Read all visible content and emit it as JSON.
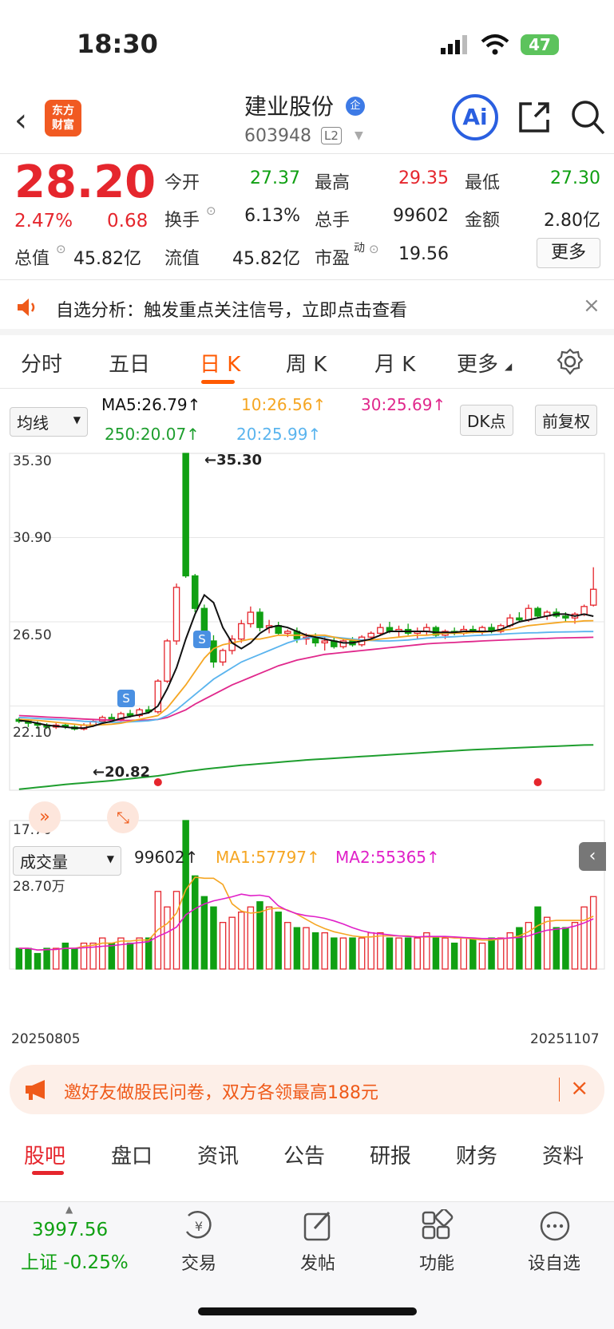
{
  "status": {
    "time": "18:30",
    "battery": "47"
  },
  "header": {
    "logo_line1": "东方",
    "logo_line2": "财富",
    "name": "建业股份",
    "name_badge": "企",
    "code": "603948",
    "level": "L2",
    "ai_label": "Ai"
  },
  "quote": {
    "price": "28.20",
    "change_pct": "2.47%",
    "change": "0.68",
    "open_label": "今开",
    "open": "27.37",
    "high_label": "最高",
    "high": "29.35",
    "low_label": "最低",
    "low": "27.30",
    "turnover_label": "换手",
    "turnover": "6.13%",
    "volume_label": "总手",
    "volume": "99602",
    "amount_label": "金额",
    "amount": "2.80亿",
    "mktcap_label": "总值",
    "mktcap": "45.82亿",
    "float_label": "流值",
    "float": "45.82亿",
    "pe_label": "市盈",
    "pe_sup": "动",
    "pe": "19.56",
    "more_button": "更多"
  },
  "notice": {
    "text": "自选分析：触发重点关注信号，立即点击查看"
  },
  "tabs": [
    "分时",
    "五日",
    "日 K",
    "周 K",
    "月 K",
    "更多"
  ],
  "ma_row": {
    "select": "均线",
    "ma5": "MA5:26.79↑",
    "ma10": "10:26.56↑",
    "ma30": "30:25.69↑",
    "ma250": "250:20.07↑",
    "ma20": "20:25.99↑",
    "dk_button": "DK点",
    "fq_button": "前复权"
  },
  "kchart": {
    "y_labels": [
      "35.30",
      "30.90",
      "26.50",
      "22.10",
      "17.70"
    ],
    "high_marker": "←35.30",
    "low_marker": "←20.82",
    "signal_label": "S"
  },
  "volume": {
    "select": "成交量",
    "value": "99602↑",
    "ma1": "MA1:57797↑",
    "ma2": "MA2:55365↑",
    "top_label": "28.70万",
    "start_date": "20250805",
    "end_date": "20251107"
  },
  "colors": {
    "up": "#e5262d",
    "down": "#10a013",
    "ma5": "#111111",
    "ma10": "#f5a623",
    "ma20": "#5ab4ee",
    "ma30": "#e0288c",
    "ma250": "#1e9e2e",
    "accent": "#ff5a00"
  },
  "chart_data": {
    "type": "candlestick",
    "x_start": "20250805",
    "x_end": "20251107",
    "ylim": [
      17.7,
      35.3
    ],
    "candles": [
      [
        21.4,
        21.5,
        21.2,
        21.3
      ],
      [
        21.3,
        21.4,
        21.0,
        21.2
      ],
      [
        21.2,
        21.3,
        20.9,
        21.1
      ],
      [
        21.1,
        21.2,
        20.9,
        21.0
      ],
      [
        21.0,
        21.2,
        20.9,
        21.1
      ],
      [
        21.1,
        21.2,
        20.9,
        21.0
      ],
      [
        21.0,
        21.1,
        20.82,
        20.9
      ],
      [
        20.9,
        21.2,
        20.82,
        21.1
      ],
      [
        21.1,
        21.4,
        21.0,
        21.3
      ],
      [
        21.3,
        21.6,
        21.2,
        21.5
      ],
      [
        21.5,
        21.7,
        21.3,
        21.4
      ],
      [
        21.4,
        21.8,
        21.3,
        21.7
      ],
      [
        21.7,
        21.9,
        21.5,
        21.6
      ],
      [
        21.6,
        22.0,
        21.5,
        21.9
      ],
      [
        21.9,
        22.1,
        21.7,
        21.8
      ],
      [
        21.8,
        23.5,
        21.7,
        23.4
      ],
      [
        23.4,
        25.6,
        23.3,
        25.5
      ],
      [
        25.5,
        28.5,
        25.3,
        28.3
      ],
      [
        35.3,
        35.3,
        28.8,
        28.9
      ],
      [
        28.9,
        29.0,
        27.0,
        27.2
      ],
      [
        27.2,
        27.4,
        25.3,
        25.5
      ],
      [
        25.5,
        25.8,
        24.1,
        24.4
      ],
      [
        24.4,
        25.1,
        24.2,
        25.0
      ],
      [
        25.0,
        25.8,
        24.8,
        25.6
      ],
      [
        25.6,
        26.6,
        25.4,
        26.4
      ],
      [
        26.4,
        27.3,
        26.2,
        27.0
      ],
      [
        27.0,
        27.2,
        26.0,
        26.2
      ],
      [
        26.2,
        26.6,
        25.9,
        26.3
      ],
      [
        26.3,
        26.5,
        25.8,
        25.9
      ],
      [
        25.9,
        26.1,
        25.7,
        26.0
      ],
      [
        26.0,
        26.2,
        25.4,
        25.6
      ],
      [
        25.6,
        25.9,
        25.3,
        25.7
      ],
      [
        25.7,
        25.9,
        25.2,
        25.4
      ],
      [
        25.4,
        25.7,
        25.0,
        25.5
      ],
      [
        25.5,
        25.7,
        25.1,
        25.2
      ],
      [
        25.2,
        25.6,
        25.1,
        25.5
      ],
      [
        25.5,
        25.7,
        25.2,
        25.3
      ],
      [
        25.3,
        25.8,
        25.2,
        25.7
      ],
      [
        25.7,
        26.0,
        25.5,
        25.9
      ],
      [
        25.9,
        26.4,
        25.8,
        26.2
      ],
      [
        26.2,
        26.5,
        25.9,
        26.0
      ],
      [
        26.0,
        26.3,
        25.7,
        26.1
      ],
      [
        26.1,
        26.4,
        25.8,
        25.9
      ],
      [
        25.9,
        26.2,
        25.6,
        26.0
      ],
      [
        26.0,
        26.4,
        25.8,
        26.2
      ],
      [
        26.2,
        26.3,
        25.7,
        25.8
      ],
      [
        25.8,
        26.1,
        25.6,
        26.0
      ],
      [
        26.0,
        26.2,
        25.8,
        25.9
      ],
      [
        25.9,
        26.3,
        25.8,
        26.1
      ],
      [
        26.1,
        26.3,
        25.9,
        26.0
      ],
      [
        26.0,
        26.3,
        25.8,
        26.2
      ],
      [
        26.2,
        26.4,
        25.9,
        26.0
      ],
      [
        26.0,
        26.4,
        25.9,
        26.3
      ],
      [
        26.3,
        26.9,
        26.2,
        26.7
      ],
      [
        26.7,
        27.0,
        26.5,
        26.6
      ],
      [
        26.6,
        27.4,
        26.5,
        27.2
      ],
      [
        27.2,
        27.3,
        26.7,
        26.8
      ],
      [
        26.8,
        27.1,
        26.6,
        27.0
      ],
      [
        27.0,
        27.2,
        26.7,
        26.8
      ],
      [
        26.8,
        27.0,
        26.5,
        26.7
      ],
      [
        26.7,
        27.0,
        26.4,
        26.9
      ],
      [
        26.9,
        27.4,
        26.8,
        27.3
      ],
      [
        27.37,
        29.35,
        27.3,
        28.2
      ]
    ],
    "volumes": [
      4,
      4,
      3,
      4,
      4,
      5,
      4,
      5,
      5,
      6,
      5,
      6,
      5,
      6,
      6,
      15,
      12,
      15,
      28.7,
      18,
      14,
      12,
      9,
      10,
      11,
      12,
      13,
      12,
      11,
      9,
      8,
      8,
      7,
      7,
      6,
      6,
      6,
      6,
      7,
      7,
      6,
      6,
      6,
      6,
      7,
      6,
      6,
      5,
      6,
      6,
      5,
      6,
      6,
      7,
      8,
      9,
      12,
      10,
      8,
      8,
      9,
      12,
      14
    ],
    "ma5": [
      21.35,
      21.3,
      21.2,
      21.1,
      21.05,
      21.0,
      20.95,
      20.95,
      21.05,
      21.2,
      21.3,
      21.45,
      21.55,
      21.65,
      21.75,
      22.1,
      23.0,
      24.1,
      25.6,
      26.9,
      27.9,
      27.5,
      26.2,
      25.4,
      25.1,
      25.4,
      25.9,
      26.2,
      26.3,
      26.2,
      26.0,
      25.8,
      25.7,
      25.6,
      25.5,
      25.4,
      25.4,
      25.5,
      25.6,
      25.8,
      26.0,
      26.0,
      26.0,
      26.0,
      26.0,
      25.95,
      25.95,
      25.95,
      26.0,
      26.0,
      26.0,
      26.0,
      26.1,
      26.3,
      26.5,
      26.6,
      26.7,
      26.8,
      26.9,
      26.9,
      26.8,
      26.9,
      26.79
    ],
    "ma10": [
      21.4,
      21.38,
      21.35,
      21.3,
      21.25,
      21.2,
      21.15,
      21.1,
      21.1,
      21.12,
      21.15,
      21.2,
      21.3,
      21.4,
      21.5,
      21.6,
      22.0,
      22.6,
      23.2,
      23.9,
      24.6,
      25.1,
      25.3,
      25.4,
      25.5,
      25.6,
      25.6,
      25.7,
      25.8,
      25.8,
      25.8,
      25.8,
      25.8,
      25.8,
      25.7,
      25.6,
      25.55,
      25.5,
      25.55,
      25.6,
      25.65,
      25.7,
      25.75,
      25.8,
      25.8,
      25.85,
      25.9,
      25.9,
      25.9,
      25.95,
      25.95,
      26.0,
      26.05,
      26.1,
      26.2,
      26.3,
      26.35,
      26.4,
      26.45,
      26.5,
      26.5,
      26.55,
      26.56
    ],
    "ma20": [
      21.5,
      21.48,
      21.45,
      21.42,
      21.4,
      21.38,
      21.35,
      21.3,
      21.28,
      21.25,
      21.25,
      21.25,
      21.27,
      21.3,
      21.33,
      21.4,
      21.6,
      21.9,
      22.3,
      22.7,
      23.1,
      23.5,
      23.8,
      24.1,
      24.4,
      24.6,
      24.8,
      25.0,
      25.2,
      25.4,
      25.55,
      25.65,
      25.7,
      25.72,
      25.7,
      25.65,
      25.6,
      25.55,
      25.52,
      25.5,
      25.5,
      25.52,
      25.55,
      25.6,
      25.65,
      25.68,
      25.7,
      25.72,
      25.75,
      25.78,
      25.8,
      25.82,
      25.85,
      25.88,
      25.9,
      25.92,
      25.93,
      25.95,
      25.96,
      25.97,
      25.98,
      25.99,
      25.99
    ],
    "ma30": [
      21.6,
      21.58,
      21.55,
      21.52,
      21.5,
      21.48,
      21.45,
      21.42,
      21.4,
      21.38,
      21.36,
      21.35,
      21.35,
      21.36,
      21.37,
      21.4,
      21.5,
      21.7,
      21.9,
      22.2,
      22.45,
      22.7,
      22.95,
      23.2,
      23.4,
      23.6,
      23.8,
      24.0,
      24.2,
      24.35,
      24.5,
      24.6,
      24.7,
      24.8,
      24.85,
      24.9,
      24.95,
      25.0,
      25.05,
      25.1,
      25.15,
      25.2,
      25.25,
      25.3,
      25.35,
      25.38,
      25.4,
      25.42,
      25.45,
      25.47,
      25.5,
      25.52,
      25.54,
      25.56,
      25.58,
      25.6,
      25.62,
      25.63,
      25.65,
      25.66,
      25.67,
      25.68,
      25.69
    ],
    "ma250": [
      17.75,
      17.8,
      17.85,
      17.9,
      17.95,
      18.0,
      18.04,
      18.08,
      18.12,
      18.16,
      18.2,
      18.25,
      18.3,
      18.35,
      18.4,
      18.45,
      18.52,
      18.6,
      18.68,
      18.74,
      18.8,
      18.85,
      18.9,
      18.95,
      19.0,
      19.04,
      19.08,
      19.12,
      19.16,
      19.2,
      19.24,
      19.28,
      19.31,
      19.34,
      19.37,
      19.4,
      19.43,
      19.46,
      19.49,
      19.52,
      19.55,
      19.58,
      19.61,
      19.64,
      19.67,
      19.7,
      19.73,
      19.76,
      19.79,
      19.82,
      19.84,
      19.86,
      19.88,
      19.9,
      19.92,
      19.94,
      19.96,
      19.98,
      20.0,
      20.02,
      20.04,
      20.06,
      20.07
    ]
  },
  "banner": {
    "text": "邀好友做股民问卷，双方各领最高188元"
  },
  "bottom_tabs": [
    "股吧",
    "盘口",
    "资讯",
    "公告",
    "研报",
    "财务",
    "资料"
  ],
  "bottom_nav": {
    "index_value": "3997.56",
    "index_label": "上证 -0.25%",
    "items": [
      "交易",
      "发帖",
      "功能",
      "设自选"
    ]
  }
}
